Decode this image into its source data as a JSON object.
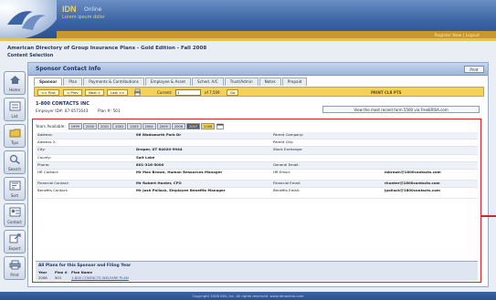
{
  "brand": {
    "title": "IDN",
    "subtitle": "Online",
    "tagline": "Lorem ipsum dolor",
    "header_links": "Register Now | Logout"
  },
  "publication": {
    "title": "American Directory of Group Insurance Plans - Gold Edition - Fall 2008",
    "subtitle": "Content Selection"
  },
  "sidebar": [
    {
      "label": "Home",
      "icon": "home-icon"
    },
    {
      "label": "List",
      "icon": "list-icon"
    },
    {
      "label": "Tips",
      "icon": "folder-icon"
    },
    {
      "label": "Search",
      "icon": "search-icon"
    },
    {
      "label": "Sort",
      "icon": "sort-icon"
    },
    {
      "label": "Contact",
      "icon": "contact-icon"
    },
    {
      "label": "Export",
      "icon": "export-icon"
    },
    {
      "label": "Print",
      "icon": "print-icon"
    }
  ],
  "panel": {
    "title": "Sponsor Contact Info",
    "print_label": "Print",
    "tabs": [
      "Sponsor",
      "Plan",
      "Payments & Contributions",
      "Employee & Asset",
      "Sched. A/C",
      "Trust/Admin",
      "Notes",
      "Prepaid"
    ],
    "active_tab": 0
  },
  "navbar": {
    "first": "<< First",
    "prev": "< Prev",
    "next": "Next >",
    "last": "Last >>",
    "current_label": "Current:",
    "current_value": "1",
    "of_text": "of 7,509",
    "go_label": "Go",
    "record_info": "PRINT CLR PTS"
  },
  "record": {
    "name": "1-800 CONTACTS INC",
    "employer_id": "Employer ID#: 87-0571643",
    "plan_no": "Plan #: 501",
    "view_link": "View the most recent form 5500 via FreeERISA.com"
  },
  "years": {
    "label": "Years Available:",
    "items": [
      "1999",
      "2000",
      "2001",
      "2002",
      "2003",
      "2004",
      "2005",
      "2006",
      "2007",
      "2008"
    ],
    "selected": 8,
    "current": 9
  },
  "details": [
    {
      "l1": "Address:",
      "v1": "66 Wadsworth Park Dr",
      "l2": "Parent Company:",
      "v2": ""
    },
    {
      "l1": "Address 2:",
      "v1": "",
      "l2": "Parent City:",
      "v2": ""
    },
    {
      "l1": "City:",
      "v1": "Draper, UT 84020-9944",
      "l2": "Stock Exchange:",
      "v2": ""
    },
    {
      "l1": "County:",
      "v1": "Salt Lake",
      "l2": "",
      "v2": ""
    },
    {
      "l1": "Phone:",
      "v1": "801-316-5000",
      "l2": "General Email:",
      "v2": ""
    },
    {
      "l1": "HR Contact:",
      "v1": "Mr Max Brown, Human Resources Manager",
      "l2": "HR Email:",
      "v2": "mbrown@1800contacts.com"
    },
    {
      "l1": "Financial Contact:",
      "v1": "Mr Robert Hunter, CFO",
      "l2": "Financial Email:",
      "v2": "rhunter@1800contacts.com"
    },
    {
      "l1": "Benefits Contact:",
      "v1": "Mr Josh Pollack, Employee Benefits Manager",
      "l2": "Benefits Email:",
      "v2": "jpollack@1800contacts.com"
    }
  ],
  "plans": {
    "title": "All Plans for this Sponsor and Filing Year",
    "headers": [
      "Year",
      "Plan #",
      "Plan Name"
    ],
    "rows": [
      {
        "year": "2008",
        "plan": "501",
        "name": "1-800 CONTACTS WELFARE PLAN"
      }
    ]
  },
  "footer": "Copyright 2008 IDN, Inc. All rights reserved. www.idnonline.com",
  "colors": {
    "accent_gold": "#f3d25c",
    "header_blue": "#3c64a4",
    "highlight_red": "#d4232e"
  }
}
